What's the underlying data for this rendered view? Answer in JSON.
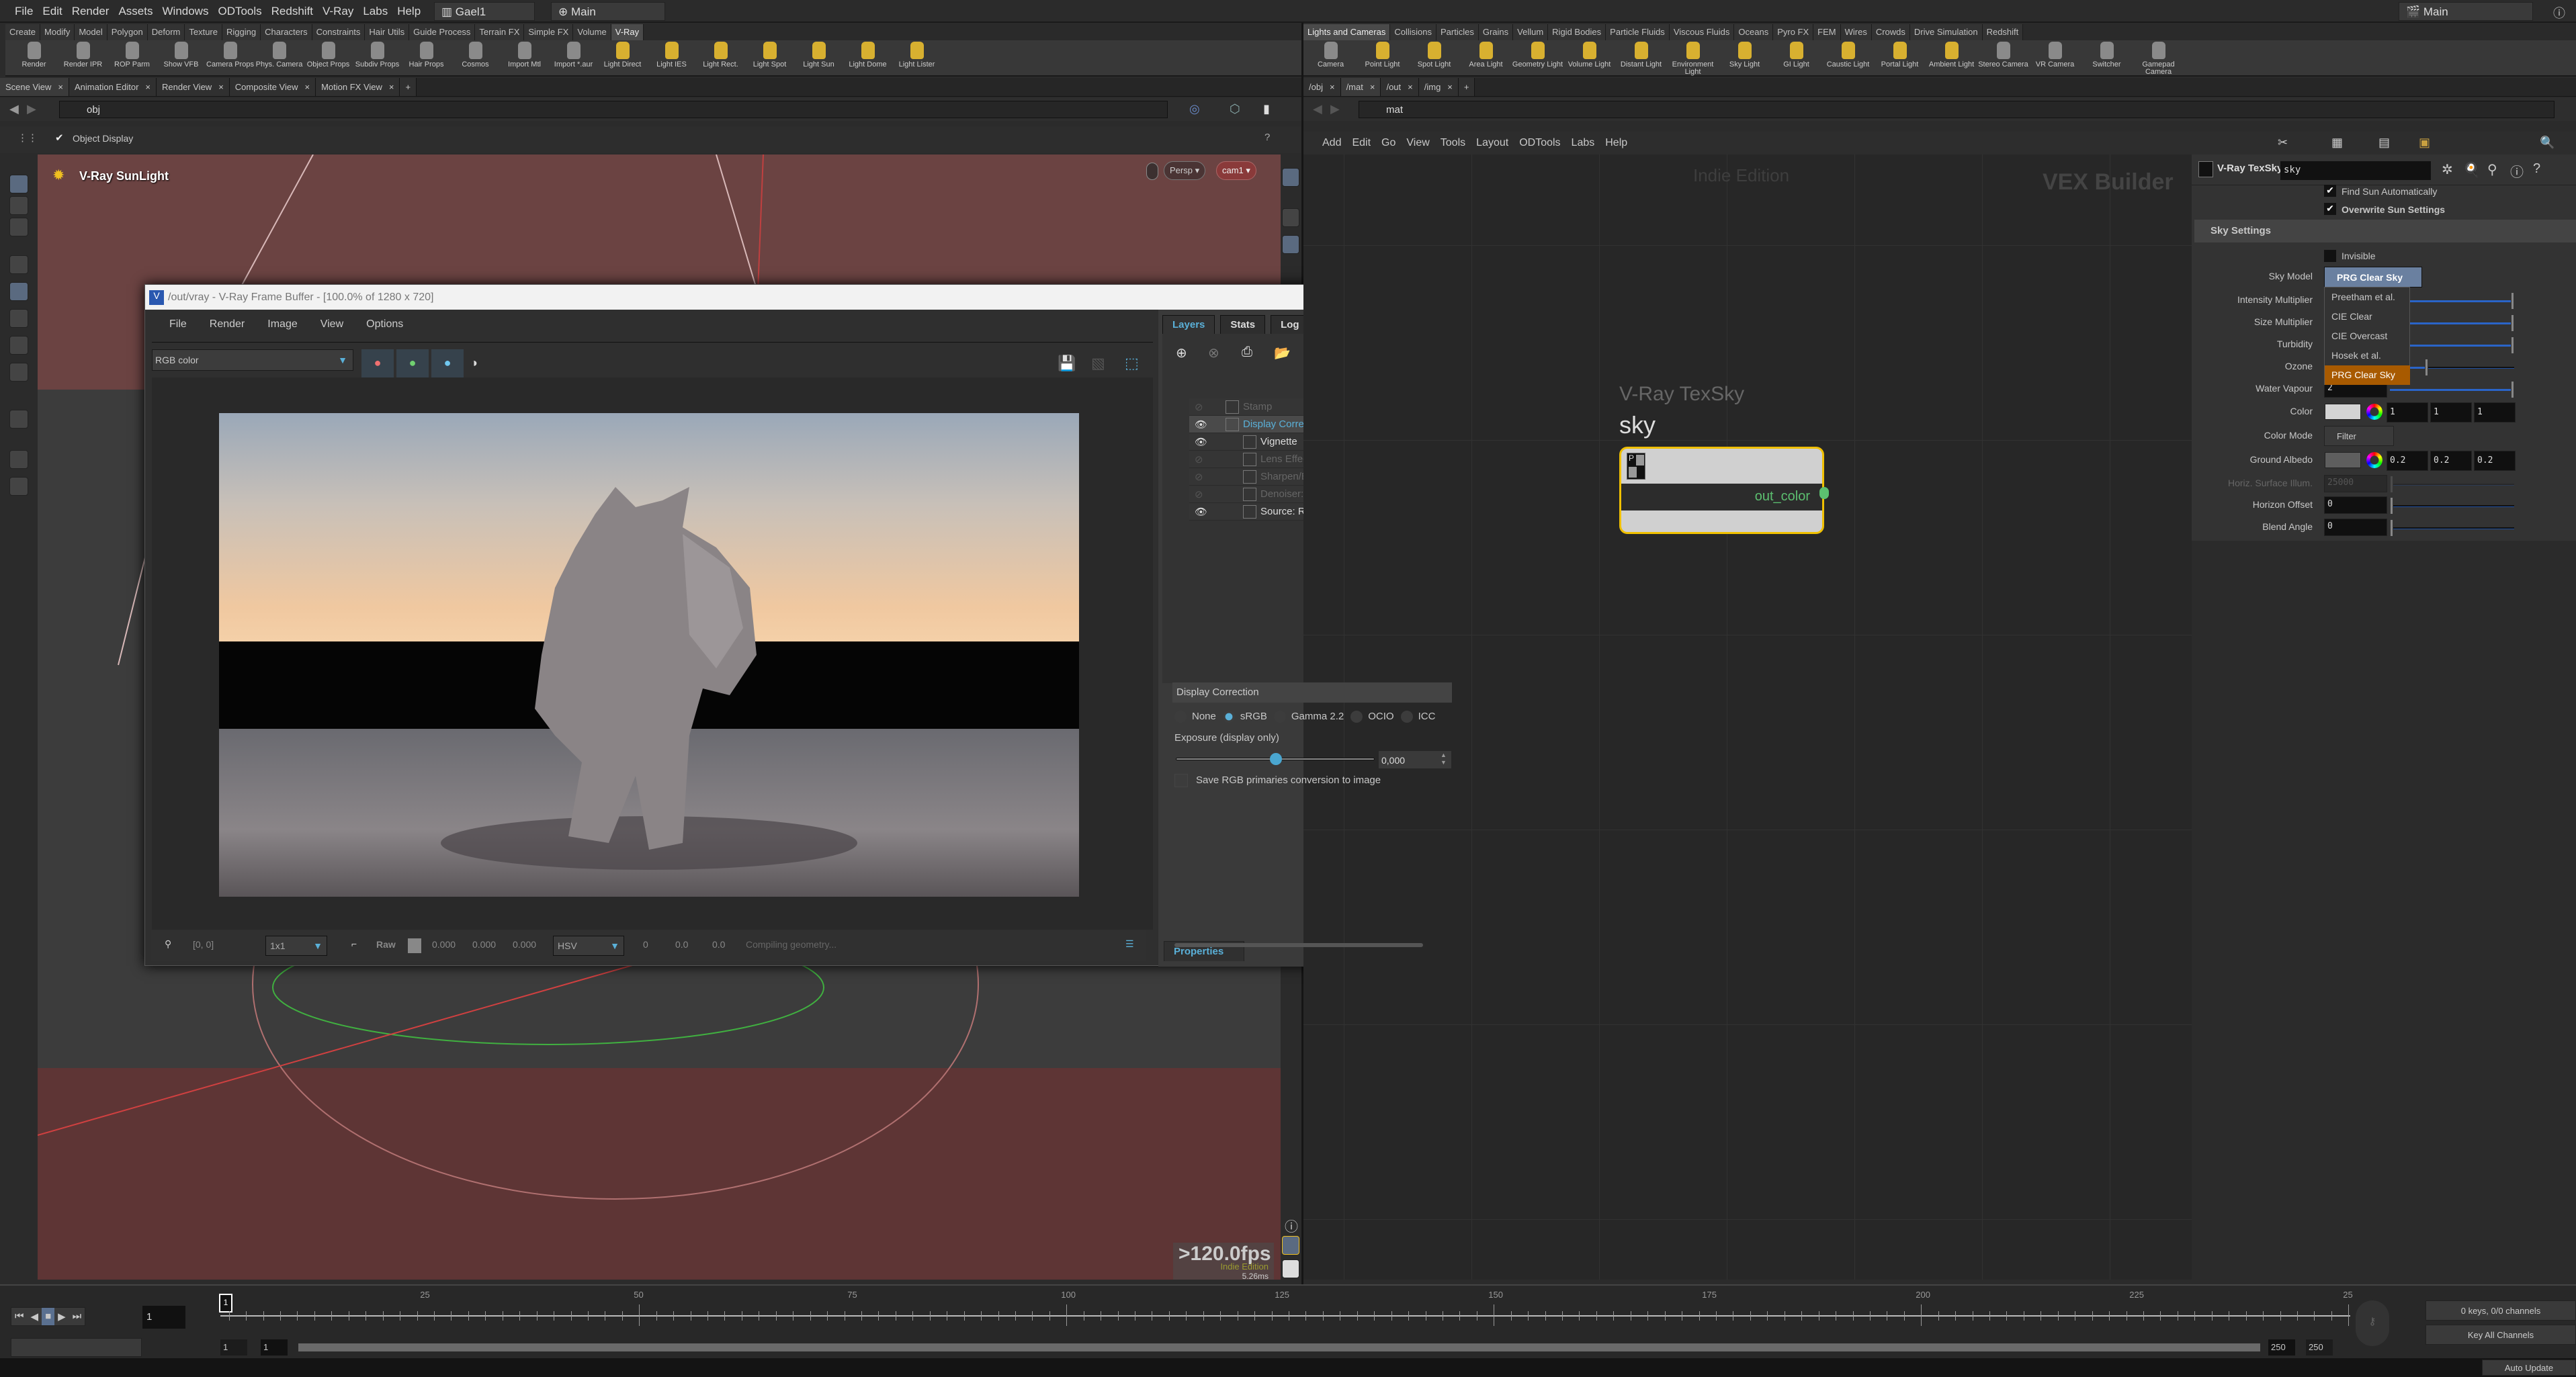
{
  "menubar": {
    "items": [
      "File",
      "Edit",
      "Render",
      "Assets",
      "Windows",
      "ODTools",
      "Redshift",
      "V-Ray",
      "Labs",
      "Help"
    ],
    "desktop": "Gael1",
    "context": "Main",
    "right_context": "Main"
  },
  "shelf_left": {
    "tabs": [
      "Create",
      "Modify",
      "Model",
      "Polygon",
      "Deform",
      "Texture",
      "Rigging",
      "Characters",
      "Constraints",
      "Hair Utils",
      "Guide Process",
      "Terrain FX",
      "Simple FX",
      "Volume",
      "V-Ray"
    ],
    "active": "V-Ray",
    "tools": [
      "Render",
      "Render IPR",
      "ROP Parm",
      "Show VFB",
      "Camera Props",
      "Phys. Camera",
      "Object Props",
      "Subdiv Props",
      "Hair Props",
      "Cosmos",
      "Import Mtl",
      "Import *.aur",
      "Light Direct",
      "Light IES",
      "Light Rect.",
      "Light Spot",
      "Light Sun",
      "Light Dome",
      "Light Lister"
    ]
  },
  "shelf_right": {
    "tabs": [
      "Lights and Cameras",
      "Collisions",
      "Particles",
      "Grains",
      "Vellum",
      "Rigid Bodies",
      "Particle Fluids",
      "Viscous Fluids",
      "Oceans",
      "Pyro FX",
      "FEM",
      "Wires",
      "Crowds",
      "Drive Simulation",
      "Redshift"
    ],
    "active": "Lights and Cameras",
    "tools": [
      "Camera",
      "Point Light",
      "Spot Light",
      "Area Light",
      "Geometry Light",
      "Volume Light",
      "Distant Light",
      "Environment Light",
      "Sky Light",
      "GI Light",
      "Caustic Light",
      "Portal Light",
      "Ambient Light",
      "Stereo Camera",
      "VR Camera",
      "Switcher",
      "Gamepad Camera"
    ]
  },
  "left_pane": {
    "tabs": [
      "Scene View",
      "Animation Editor",
      "Render View",
      "Composite View",
      "Motion FX View"
    ],
    "path": "obj",
    "object_display": "Object Display",
    "viewport": {
      "light_label": "V-Ray SunLight",
      "view": "Persp",
      "camera": "cam1",
      "fps": ">120.0fps",
      "edition": "Indie Edition",
      "ms": "5.26ms"
    }
  },
  "right_pane": {
    "tabs": [
      "/obj",
      "/mat",
      "/out",
      "/img"
    ],
    "active": "/mat",
    "path": "mat",
    "menu": [
      "Add",
      "Edit",
      "Go",
      "View",
      "Tools",
      "Layout",
      "ODTools",
      "Labs",
      "Help"
    ],
    "watermark": "Indie Edition",
    "context_label": "VEX Builder",
    "node": {
      "type": "V-Ray TexSky",
      "name": "sky",
      "output": "out_color"
    }
  },
  "params": {
    "node_type": "V-Ray TexSky",
    "node_name": "sky",
    "find_sun": {
      "label": "Find Sun Automatically",
      "checked": true
    },
    "overwrite_sun": {
      "label": "Overwrite Sun Settings",
      "checked": true
    },
    "section": "Sky Settings",
    "invisible": {
      "label": "Invisible",
      "checked": false
    },
    "sky_model": {
      "label": "Sky Model",
      "value": "PRG Clear Sky",
      "options": [
        "Preetham et al.",
        "CIE Clear",
        "CIE Overcast",
        "Hosek et al.",
        "PRG Clear Sky"
      ]
    },
    "intensity": {
      "label": "Intensity Multiplier"
    },
    "size": {
      "label": "Size Multiplier"
    },
    "turbidity": {
      "label": "Turbidity"
    },
    "ozone": {
      "label": "Ozone"
    },
    "water_vapour": {
      "label": "Water Vapour",
      "value": "2"
    },
    "color": {
      "label": "Color",
      "values": [
        "1",
        "1",
        "1"
      ],
      "swatch": "#d4d4d4"
    },
    "color_mode": {
      "label": "Color Mode",
      "value": "Filter"
    },
    "ground_albedo": {
      "label": "Ground Albedo",
      "values": [
        "0.2",
        "0.2",
        "0.2"
      ],
      "swatch": "#5e5e5e"
    },
    "horiz_illum": {
      "label": "Horiz. Surface Illum.",
      "value": "25000"
    },
    "horizon_offset": {
      "label": "Horizon Offset",
      "value": "0"
    },
    "blend_angle": {
      "label": "Blend Angle",
      "value": "0"
    }
  },
  "vfb": {
    "title": "/out/vray - V-Ray Frame Buffer - [100.0% of 1280 x 720]",
    "menu": [
      "File",
      "Render",
      "Image",
      "View",
      "Options"
    ],
    "channel": "RGB color",
    "tabs": [
      "Layers",
      "Stats",
      "Log"
    ],
    "active_tab": "Layers",
    "layers": [
      {
        "name": "Stamp",
        "visible": false
      },
      {
        "name": "Display Correction",
        "visible": true,
        "selected": true
      },
      {
        "name": "Vignette",
        "visible": true
      },
      {
        "name": "Lens Effects",
        "visible": false
      },
      {
        "name": "Sharpen/Blur",
        "visible": false
      },
      {
        "name": "Denoiser: unavailable",
        "visible": false
      },
      {
        "name": "Source: RGB",
        "visible": true
      }
    ],
    "properties": {
      "tab": "Properties",
      "header": "Display Correction",
      "modes": [
        "None",
        "sRGB",
        "Gamma 2.2",
        "OCIO",
        "ICC"
      ],
      "selected_mode": "sRGB",
      "exposure_label": "Exposure (display only)",
      "exposure": "0,000",
      "exposure_fraction": 0.5,
      "save_label": "Save RGB primaries conversion to image"
    },
    "status": {
      "coords": "[0, 0]",
      "sample": "1x1",
      "raw": "Raw",
      "rgb": [
        "0.000",
        "0.000",
        "0.000"
      ],
      "space": "HSV",
      "hsv": [
        "0",
        "0.0",
        "0.0"
      ],
      "message": "Compiling geometry..."
    }
  },
  "timeline": {
    "current_frame": "1",
    "ticks": [
      "25",
      "50",
      "75",
      "100",
      "125",
      "150",
      "175",
      "200",
      "225",
      "25"
    ],
    "start": "1",
    "start2": "1",
    "end": "250",
    "end2": "250",
    "keys": "0 keys, 0/0 channels",
    "key_mode": "Key All Channels",
    "update": "Auto Update"
  },
  "colors": {
    "viewport": "#6b4342",
    "accent": "#5ab0d8",
    "highlight": "#a85a00",
    "node_border": "#f0c000",
    "output": "#5cc070"
  }
}
